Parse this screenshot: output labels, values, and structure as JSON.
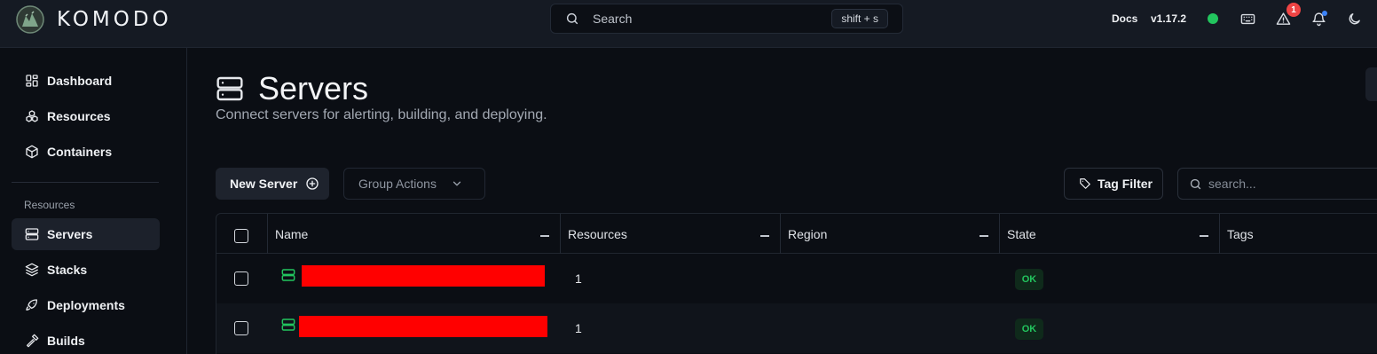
{
  "app": {
    "name": "KOMODO"
  },
  "search": {
    "label": "Search",
    "shortcut": "shift + s"
  },
  "topbar": {
    "docs": "Docs",
    "version": "v1.17.2",
    "alerts_count": "1"
  },
  "sidebar": {
    "items_top": [
      {
        "label": "Dashboard",
        "icon": "dashboard-icon"
      },
      {
        "label": "Resources",
        "icon": "boxes-icon"
      },
      {
        "label": "Containers",
        "icon": "box-icon"
      }
    ],
    "section_label": "Resources",
    "items_resources": [
      {
        "label": "Servers",
        "icon": "server-icon",
        "active": true
      },
      {
        "label": "Stacks",
        "icon": "layers-icon"
      },
      {
        "label": "Deployments",
        "icon": "rocket-icon"
      },
      {
        "label": "Builds",
        "icon": "hammer-icon"
      }
    ]
  },
  "page": {
    "title": "Servers",
    "subtitle": "Connect servers for alerting, building, and deploying."
  },
  "toolbar": {
    "new_label": "New Server",
    "group_actions_label": "Group Actions",
    "tag_filter_label": "Tag Filter",
    "search_placeholder": "search..."
  },
  "table": {
    "columns": [
      "Name",
      "Resources",
      "Region",
      "State",
      "Tags"
    ],
    "rows": [
      {
        "name_redacted": true,
        "resources": "1",
        "region": "",
        "state": "OK",
        "tags": ""
      },
      {
        "name_redacted": true,
        "resources": "1",
        "region": "",
        "state": "OK",
        "tags": ""
      }
    ]
  },
  "colors": {
    "background": "#0b0e14",
    "topbar": "#151a23",
    "accent_green": "#22c55e",
    "alert_red": "#ef4444",
    "redaction": "#ff0000"
  }
}
